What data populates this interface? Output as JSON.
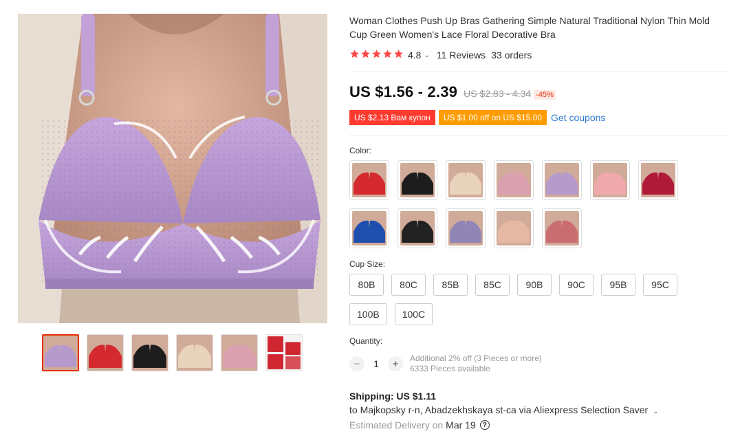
{
  "product": {
    "title": "Woman Clothes Push Up Bras Gathering Simple Natural Traditional Nylon Thin Mold Cup Green Women's Lace Floral Decorative Bra",
    "rating": "4.8",
    "rating_chevron": "⌄",
    "reviews": "11 Reviews",
    "orders": "33 orders",
    "stars": 5
  },
  "price": {
    "current": "US $1.56 - 2.39",
    "original": "US $2.83 - 4.34",
    "discount": "-45%"
  },
  "coupons": {
    "coupon1": "US $2.13 Вам купон",
    "coupon2": "US $1.00 off on US $15.00",
    "get_label": "Get coupons"
  },
  "color": {
    "label": "Color:",
    "options": [
      {
        "name": "red",
        "hex": "#d42a2f"
      },
      {
        "name": "black",
        "hex": "#1d1d1d"
      },
      {
        "name": "beige",
        "hex": "#e8d3bc"
      },
      {
        "name": "pink",
        "hex": "#dba0b0"
      },
      {
        "name": "lavender",
        "hex": "#b59acb"
      },
      {
        "name": "light-pink",
        "hex": "#efa9ad"
      },
      {
        "name": "wine",
        "hex": "#b01a3a"
      },
      {
        "name": "blue",
        "hex": "#1f4fae"
      },
      {
        "name": "black-2",
        "hex": "#222222"
      },
      {
        "name": "grey-purple",
        "hex": "#8f86b6"
      },
      {
        "name": "nude",
        "hex": "#e4b8a3"
      },
      {
        "name": "rose",
        "hex": "#c96d72"
      }
    ]
  },
  "cup": {
    "label": "Cup Size:",
    "sizes": [
      "80B",
      "80C",
      "85B",
      "85C",
      "90B",
      "90C",
      "95B",
      "95C",
      "100B",
      "100C"
    ]
  },
  "quantity": {
    "label": "Quantity:",
    "value": "1",
    "minus": "−",
    "plus": "+",
    "note1": "Additional 2% off (3 Pieces or more)",
    "note2": "6333 Pieces available"
  },
  "shipping": {
    "title": "Shipping: US $1.11",
    "to": "to Majkopsky r-n, Abadzekhskaya st-ca via Aliexpress Selection Saver",
    "chevron": "⌄",
    "delivery_label": "Estimated Delivery on",
    "delivery_date": "Mar 19",
    "help": "?"
  },
  "gallery": {
    "thumbs": [
      {
        "name": "lavender",
        "hex": "#b59acb"
      },
      {
        "name": "red",
        "hex": "#d42a2f"
      },
      {
        "name": "black",
        "hex": "#1d1d1d"
      },
      {
        "name": "beige",
        "hex": "#e8d3bc"
      },
      {
        "name": "pink",
        "hex": "#dba0b0"
      },
      {
        "name": "red-pattern",
        "hex": "#cf2631"
      }
    ],
    "main_color": "#b99bd0",
    "accent": "#e62e04"
  }
}
